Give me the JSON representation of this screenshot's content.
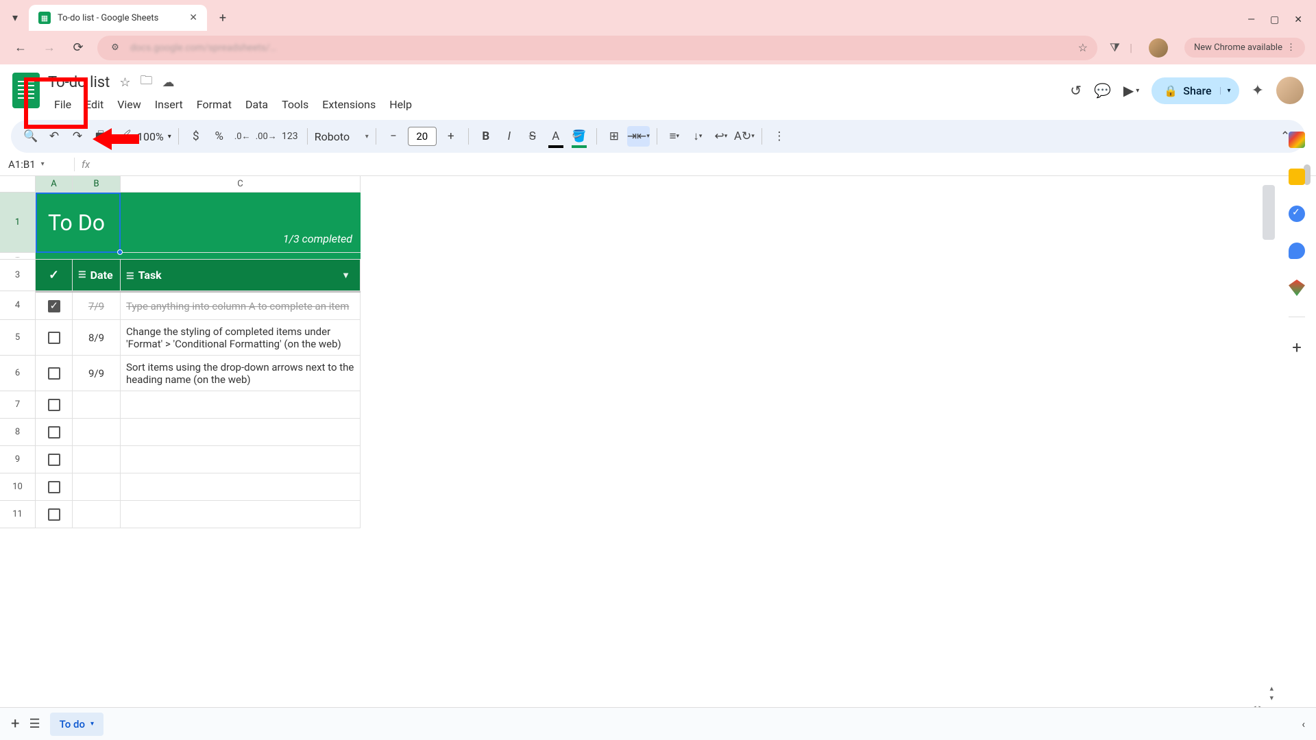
{
  "browser": {
    "tab_title": "To-do list - Google Sheets",
    "update_label": "New Chrome available"
  },
  "doc": {
    "title": "To-do list",
    "menus": [
      "File",
      "Edit",
      "View",
      "Insert",
      "Format",
      "Data",
      "Tools",
      "Extensions",
      "Help"
    ],
    "share_label": "Share"
  },
  "toolbar": {
    "zoom": "100%",
    "font_name": "Roboto",
    "font_size": "20"
  },
  "namebox": "A1:B1",
  "columns": [
    "A",
    "B",
    "C"
  ],
  "sheet": {
    "title": "To Do",
    "completed": "1/3 completed",
    "headers": {
      "check": "✓",
      "date": "Date",
      "task": "Task"
    },
    "rows": [
      {
        "checked": true,
        "date": "7/9",
        "task": "Type anything into column A to complete an item",
        "strike": true
      },
      {
        "checked": false,
        "date": "8/9",
        "task": "Change the styling of completed items under 'Format' > 'Conditional Formatting' (on the web)"
      },
      {
        "checked": false,
        "date": "9/9",
        "task": "Sort items using the drop-down arrows next to the heading name (on the web)"
      }
    ],
    "row_numbers": [
      1,
      3,
      4,
      5,
      6,
      7,
      8,
      9,
      10,
      11
    ]
  },
  "sheet_tab": "To do"
}
